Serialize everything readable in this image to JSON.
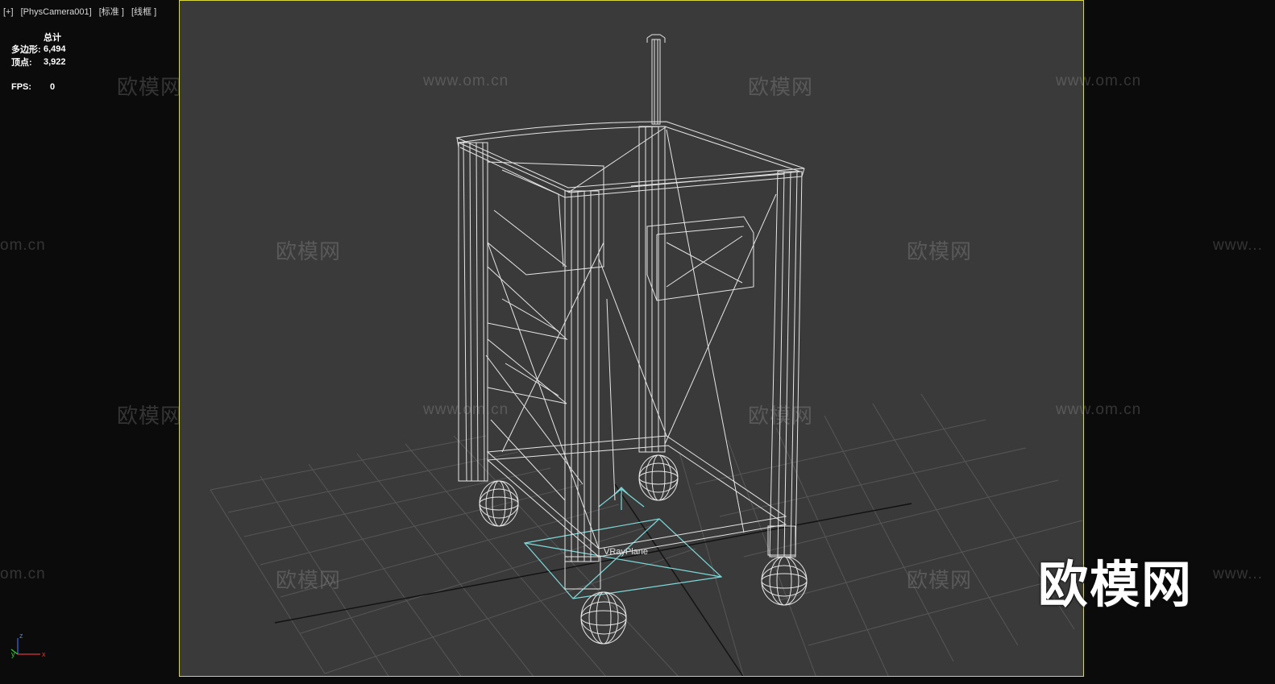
{
  "viewport_label": {
    "plus": "[+]",
    "camera": "[PhysCamera001]",
    "shading": "[标准 ]",
    "mode": "[线框 ]"
  },
  "stats": {
    "header": "总计",
    "polys_label": "多边形:",
    "polys_value": "6,494",
    "verts_label": "顶点:",
    "verts_value": "3,922",
    "fps_label": "FPS:",
    "fps_value": "0"
  },
  "scene": {
    "object_label": "VRayPlane",
    "wire_color": "#e8e8e8",
    "plane_color": "#7fd8d8",
    "grid_color": "#555555",
    "viewport_border_color": "#d8d83a"
  },
  "watermarks": {
    "brand": "欧模网",
    "url": "www.om.cn",
    "url_partial_left": "om.cn",
    "url_partial_right": "www..."
  },
  "logo": {
    "text": "欧模网"
  },
  "axis_gizmo": {
    "x": "x",
    "y": "y",
    "z": "z"
  }
}
